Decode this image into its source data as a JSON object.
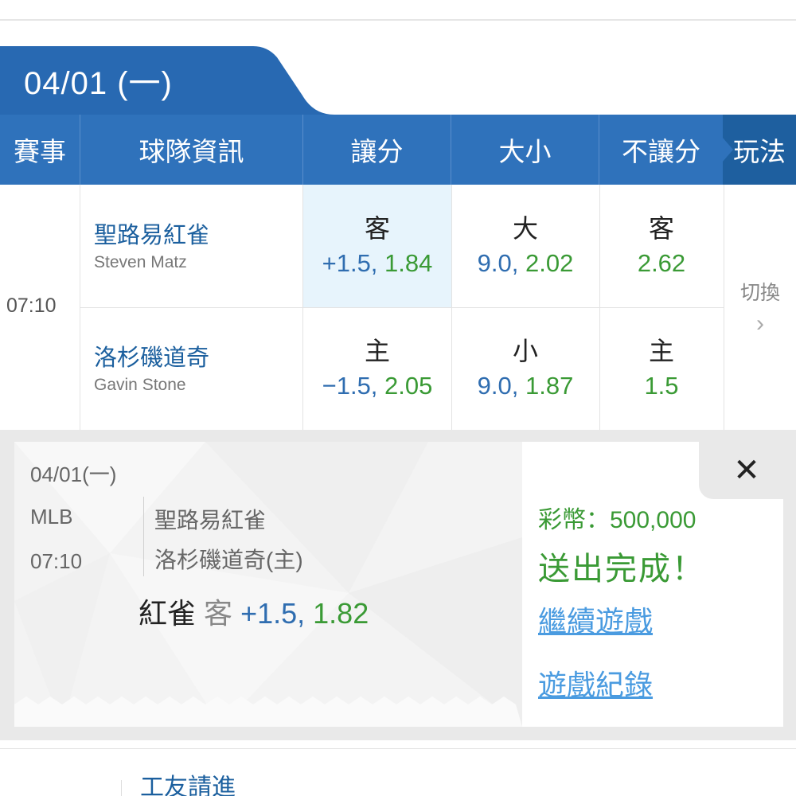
{
  "date_tab": {
    "label": "04/01 (一)"
  },
  "header": {
    "event": "賽事",
    "team_info": "球隊資訊",
    "handicap": "讓分",
    "over_under": "大小",
    "moneyline": "不讓分",
    "play": "玩法"
  },
  "match": {
    "time": "07:10",
    "away": {
      "name": "聖路易紅雀",
      "pitcher": "Steven Matz"
    },
    "home": {
      "name": "洛杉磯道奇",
      "pitcher": "Gavin Stone"
    },
    "handicap": {
      "away": {
        "label": "客",
        "line": "+1.5,",
        "odds": "1.84"
      },
      "home": {
        "label": "主",
        "line": "−1.5,",
        "odds": "2.05"
      }
    },
    "over_under": {
      "over": {
        "label": "大",
        "line": "9.0,",
        "odds": "2.02"
      },
      "under": {
        "label": "小",
        "line": "9.0,",
        "odds": "1.87"
      }
    },
    "moneyline": {
      "away": {
        "label": "客",
        "odds": "2.62"
      },
      "home": {
        "label": "主",
        "odds": "1.5"
      }
    },
    "switch_label": "切換",
    "switch_arrow": "›"
  },
  "receipt": {
    "date": "04/01(一)",
    "league": "MLB",
    "time": "07:10",
    "team1": "聖路易紅雀",
    "team2": "洛杉磯道奇(主)",
    "bet_selection": "紅雀",
    "bet_side": "客",
    "bet_line": "+1.5,",
    "bet_odds": "1.82",
    "coins": "彩幣：500,000",
    "status": "送出完成！",
    "continue_link": "繼續遊戲",
    "history_link": "遊戲紀錄",
    "close": "✕"
  },
  "bottom": {
    "title": "工友請進"
  },
  "colors": {
    "header_blue": "#2f72bb",
    "tab_blue": "#2869b2",
    "green": "#3a9a35",
    "link_blue": "#4a9be0"
  }
}
